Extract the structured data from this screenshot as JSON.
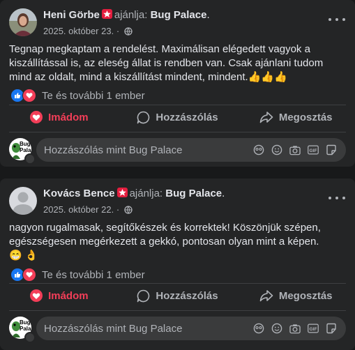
{
  "posts": [
    {
      "author": "Heni Görbe",
      "recommends_text": "ajánlja:",
      "page_name": "Bug Palace",
      "period": ".",
      "date": "2025. október 23.",
      "separator": "·",
      "text": "Tegnap megkaptam a rendelést. Maximálisan elégedett vagyok a kiszállítással is, az eleség állat is rendben van. Csak ajánlani tudom mind az oldalt, mind a kiszállítást mindent, mindent.",
      "emoji": "👍👍👍",
      "reactions_text": "Te és további 1 ember"
    },
    {
      "author": "Kovács Bence",
      "recommends_text": "ajánlja:",
      "page_name": "Bug Palace",
      "period": ".",
      "date": "2025. október 22.",
      "separator": "·",
      "text": "nagyon rugalmasak, segítőkészek és korrektek! Köszönjük szépen, egészségesen megérkezett a gekkó, pontosan olyan mint a képen.",
      "emoji": "😁 👌",
      "reactions_text": "Te és további 1 ember"
    }
  ],
  "actions": {
    "love_label": "Imádom",
    "comment_label": "Hozzászólás",
    "share_label": "Megosztás"
  },
  "comment_box": {
    "placeholder": "Hozzászólás mint Bug Palace",
    "page_avatar_text": "Bug Pala"
  },
  "colors": {
    "background": "#18191a",
    "card": "#242526",
    "love_red": "#f33e58",
    "like_blue": "#1877f2",
    "muted_text": "#b0b3b8"
  },
  "icons": [
    "star-badge-icon",
    "globe-icon",
    "more-options-icon",
    "like-reaction-icon",
    "love-reaction-icon",
    "heart-icon",
    "comment-bubble-icon",
    "share-arrow-icon",
    "avatar-icon",
    "sticker-icon",
    "emoji-icon",
    "camera-icon",
    "gif-icon",
    "sticker-note-icon"
  ]
}
